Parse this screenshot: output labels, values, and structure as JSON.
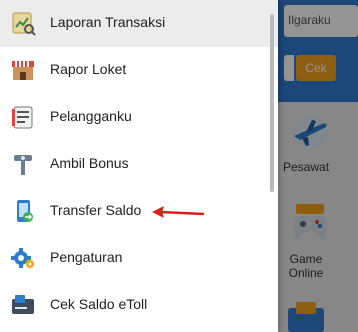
{
  "background_app": {
    "search_text": "Ilgaraku",
    "check_button": "Cek",
    "services": [
      {
        "label": "Pesawat",
        "icon": "airplane-icon"
      },
      {
        "label": "Game Online",
        "icon": "gamepad-icon"
      }
    ]
  },
  "drawer": {
    "items": [
      {
        "label": "Laporan Transaksi",
        "icon": "report-chart-icon",
        "active": true
      },
      {
        "label": "Rapor Loket",
        "icon": "store-icon",
        "active": false
      },
      {
        "label": "Pelangganku",
        "icon": "customer-list-icon",
        "active": false
      },
      {
        "label": "Ambil Bonus",
        "icon": "bonus-pin-icon",
        "active": false
      },
      {
        "label": "Transfer Saldo",
        "icon": "phone-transfer-icon",
        "active": false
      },
      {
        "label": "Pengaturan",
        "icon": "gear-icon",
        "active": false
      },
      {
        "label": "Cek Saldo eToll",
        "icon": "etoll-card-icon",
        "active": false
      }
    ]
  },
  "annotation": {
    "icon": "red-arrow-icon",
    "color": "#e01b1b"
  },
  "colors": {
    "header_blue": "#2f7bd0",
    "accent_orange": "#f5a21d"
  }
}
